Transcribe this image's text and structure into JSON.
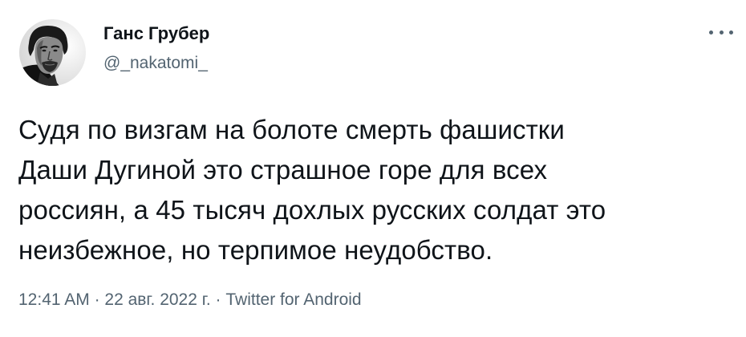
{
  "author": {
    "display_name": "Ганс Грубер",
    "handle": "@_nakatomi_",
    "avatar_icon": "profile-photo"
  },
  "more_icon": "more-horizontal-icon",
  "tweet": {
    "lines": [
      "Судя по визгам на болоте смерть фашистки",
      "Даши Дугиной это страшное горе для всех",
      "россиян, а 45 тысяч дохлых русских солдат это",
      "неизбежное, но терпимое неудобство."
    ]
  },
  "meta": {
    "time": "12:41 AM",
    "separator": " · ",
    "date": "22 авг. 2022 г.",
    "source": "Twitter for Android"
  },
  "colors": {
    "text_primary": "#0f1419",
    "text_secondary": "#536471",
    "background": "#ffffff"
  }
}
